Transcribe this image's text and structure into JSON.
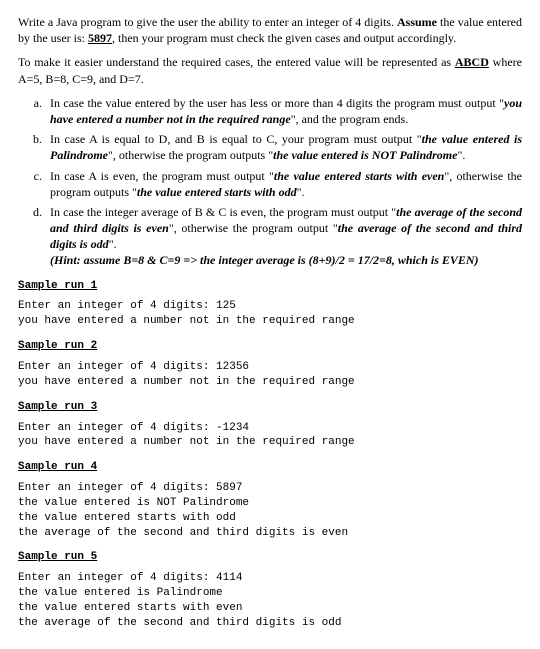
{
  "intro": {
    "p1_a": "Write a Java program to give the user the ability to enter an integer of 4 digits. ",
    "p1_b": "Assume",
    "p1_c": " the value entered by the user is: ",
    "p1_d": "5897",
    "p1_e": ", then your program must check the given cases and output accordingly.",
    "p2_a": "To make it easier understand the required cases, the entered value will be represented as ",
    "p2_b": "ABCD",
    "p2_c": " where A=5, B=8, C=9, and D=7."
  },
  "items": {
    "a": {
      "marker": "a.",
      "t1": "In case the value entered by the user has less or more than 4 digits the program must output \"",
      "t2": "you have entered a number not in the required range",
      "t3": "\", and the program ends."
    },
    "b": {
      "marker": "b.",
      "t1": "In case A is equal to D, and B is equal to C, your program must output \"",
      "t2": "the value entered is Palindrome",
      "t3": "\", otherwise the program outputs \"",
      "t4": "the value entered is NOT Palindrome",
      "t5": "\"."
    },
    "c": {
      "marker": "c.",
      "t1": "In case A is even, the program must output \"",
      "t2": "the value entered starts with even",
      "t3": "\", otherwise the program outputs \"",
      "t4": "the value entered starts with odd",
      "t5": "\"."
    },
    "d": {
      "marker": "d.",
      "t1": "In case the integer average of B & C is even, the program must output \"",
      "t2": "the average of the second and third digits is even",
      "t3": "\", otherwise the program output \"",
      "t4": "the average of the second and third digits is odd",
      "t5": "\".",
      "hint": "(Hint: assume B=8 & C=9 => the integer average is (8+9)/2 = 17/2=8, which is EVEN)"
    }
  },
  "samples": {
    "s1": {
      "heading": "Sample run 1",
      "body": "Enter an integer of 4 digits: 125\nyou have entered a number not in the required range"
    },
    "s2": {
      "heading": "Sample run 2",
      "body": "Enter an integer of 4 digits: 12356\nyou have entered a number not in the required range"
    },
    "s3": {
      "heading": "Sample run 3",
      "body": "Enter an integer of 4 digits: -1234\nyou have entered a number not in the required range"
    },
    "s4": {
      "heading": "Sample run 4",
      "body": "Enter an integer of 4 digits: 5897\nthe value entered is NOT Palindrome\nthe value entered starts with odd\nthe average of the second and third digits is even"
    },
    "s5": {
      "heading": "Sample run 5",
      "body": "Enter an integer of 4 digits: 4114\nthe value entered is Palindrome\nthe value entered starts with even\nthe average of the second and third digits is odd"
    }
  }
}
